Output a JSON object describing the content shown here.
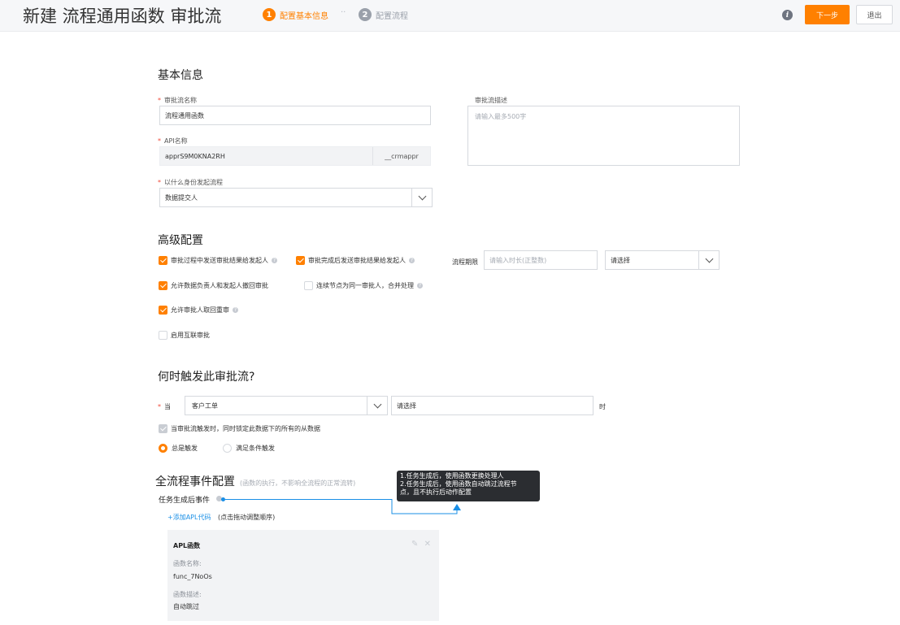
{
  "header": {
    "title": "新建 流程通用函数 审批流",
    "steps": [
      {
        "number": "1",
        "label": "配置基本信息",
        "active": true
      },
      {
        "number": "2",
        "label": "配置流程",
        "active": false
      }
    ],
    "step_separator": "··",
    "info_icon": "i",
    "next_label": "下一步",
    "exit_label": "退出"
  },
  "basic": {
    "title": "基本信息",
    "name_label": "审批流名称",
    "name_value": "流程通用函数",
    "api_label": "API名称",
    "api_value": "apprS9M0KNA2RH",
    "api_suffix": "__crmappr",
    "initiator_label": "以什么身份发起流程",
    "initiator_value": "数据提交人",
    "desc_label": "审批流描述",
    "desc_placeholder": "请输入最多500字",
    "required_mark": "*"
  },
  "advanced": {
    "title": "高级配置",
    "options": [
      {
        "label": "审批过程中发送审批结果给发起人",
        "checked": true,
        "help": true
      },
      {
        "label": "审批完成后发送审批结果给发起人",
        "checked": true,
        "help": true
      },
      {
        "label": "允许数据负责人和发起人撤回审批",
        "checked": true,
        "help": false
      },
      {
        "label": "连续节点为同一审批人，合并处理",
        "checked": false,
        "help": true
      },
      {
        "label": "允许审批人取回重审",
        "checked": true,
        "help": true
      },
      {
        "label": "启用互联审批",
        "checked": false,
        "help": false
      }
    ],
    "period_label": "流程期限",
    "period_placeholder": "请输入时长(正整数)",
    "period_unit": "请选择"
  },
  "trigger": {
    "title": "何时触发此审批流?",
    "when_label": "当",
    "object_value": "客户工单",
    "event_value": "请选择",
    "suffix": "时",
    "lock_label": "当审批流触发时，同时锁定此数据下的所有的从数据",
    "radio_always": "总是触发",
    "radio_condition": "满足条件触发"
  },
  "events": {
    "title": "全流程事件配置",
    "subtitle": "(函数的执行，不影响全流程的正常流转)",
    "task_event_label": "任务生成后事件",
    "add_apl": "+添加APL代码",
    "drag_hint": "(点击拖动调整顺序)",
    "tooltip_lines": [
      "1.任务生成后，使用函数更换处理人",
      "2.任务生成后，使用函数自动跳过流程节",
      "点，且不执行后动作配置"
    ],
    "card": {
      "title": "APL函数",
      "func_name_label": "函数名称:",
      "func_name": "func_7NoOs",
      "func_desc_label": "函数描述:",
      "func_desc": "自动跳过"
    }
  },
  "colors": {
    "accent": "#ff8000",
    "link": "#1a8fe6",
    "required": "#f04a3a"
  }
}
